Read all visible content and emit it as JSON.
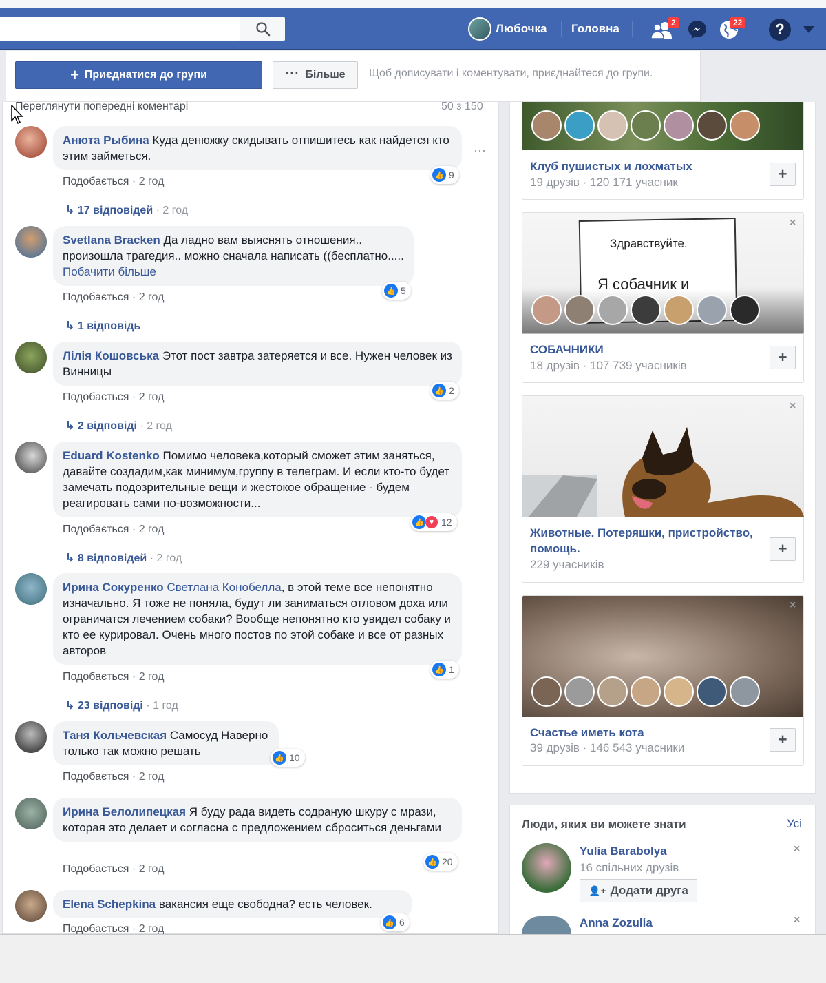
{
  "header": {
    "user_name": "Любочка",
    "home_label": "Головна",
    "friend_requests_badge": "2",
    "notifications_badge": "22",
    "icons": [
      "search-icon",
      "friends-icon",
      "messenger-icon",
      "globe-icon",
      "help-icon",
      "chevron-down-icon"
    ],
    "accent_color": "#4267b2"
  },
  "join_bar": {
    "join_label": "Приєднатися до групи",
    "more_label": "Більше",
    "hint": "Щоб дописувати і коментувати, приєднайтеся до групи."
  },
  "comments_header": {
    "view_previous": "Переглянути попередні коментарі",
    "count": "50 з 150"
  },
  "comments": [
    {
      "author": "Анюта Рыбина",
      "text": "Куда денюжку скидывать отпишитесь как найдется кто этим займеться.",
      "reactions": "9",
      "like_label": "Подобається",
      "time": "2 год",
      "replies": "17 відповідей",
      "replies_time": "2 год"
    },
    {
      "author": "Svetlana Bracken",
      "text": "Да ладно вам выяснять отношения.. произошла трагедия.. можно сначала написать ((бесплатно.....",
      "see_more": "Побачити більше",
      "reactions": "5",
      "like_label": "Подобається",
      "time": "2 год",
      "replies": "1 відповідь",
      "replies_time": ""
    },
    {
      "author": "Лілія Кошовська",
      "text": "Этот пост завтра затеряется и все. Нужен человек из Винницы",
      "reactions": "2",
      "like_label": "Подобається",
      "time": "2 год",
      "replies": "2 відповіді",
      "replies_time": "2 год"
    },
    {
      "author": "Eduard Kostenko",
      "text": "Помимо человека,который сможет этим заняться, давайте создадим,как минимум,группу в телеграм. И если кто-то будет замечать подозрительные вещи и жестокое обращение - будем реагировать сами по-возможности...",
      "reactions": "12",
      "like_label": "Подобається",
      "time": "2 год",
      "replies": "8 відповідей",
      "replies_time": "2 год"
    },
    {
      "author": "Ирина Сокуренко",
      "mention": "Светлана Конобелла",
      "text": ", в этой теме все непонятно изначально. Я тоже не поняла, будут ли заниматься отловом доха или ограничатся лечением собаки? Вообще непонятно кто увидел собаку и кто ее курировал. Очень много постов по этой собаке и все от разных авторов",
      "reactions": "1",
      "like_label": "Подобається",
      "time": "2 год",
      "replies": "23 відповіді",
      "replies_time": "1 год"
    },
    {
      "author": "Таня Кольчевская",
      "text": "Самосуд Наверно только так можно решать",
      "reactions": "10",
      "like_label": "Подобається",
      "time": "2 год"
    },
    {
      "author": "Ирина Белолипецкая",
      "text": "Я буду рада видеть содраную шкуру с мрази, которая это делает и согласна с предложением сброситься деньгами",
      "reactions": "20",
      "like_label": "Подобається",
      "time": "2 год"
    },
    {
      "author": "Elena Schepkina",
      "text": "вакансия еще свободна? есть человек.",
      "reactions": "6",
      "like_label": "Подобається",
      "time": "2 год"
    }
  ],
  "groups": [
    {
      "name": "Клуб пушистых и лохматых",
      "stats": "19 друзів · 120 171 учасник"
    },
    {
      "name": "СОБАЧНИКИ",
      "stats": "18 друзів · 107 739 учасників",
      "image_text_1": "Здравствуйте.",
      "image_text_2": "Я собачник и"
    },
    {
      "name": "Животные. Потеряшки, пристройство, помощь.",
      "stats": "229 учасників"
    },
    {
      "name": "Счастье иметь кота",
      "stats": "39 друзів · 146 543 учасники"
    }
  ],
  "people": {
    "title": "Люди, яких ви можете знати",
    "see_all": "Усі",
    "items": [
      {
        "name": "Yulia Barabolya",
        "mutual": "16 спільних друзів",
        "add_label": "Додати друга"
      },
      {
        "name": "Anna Zozulia"
      }
    ]
  }
}
